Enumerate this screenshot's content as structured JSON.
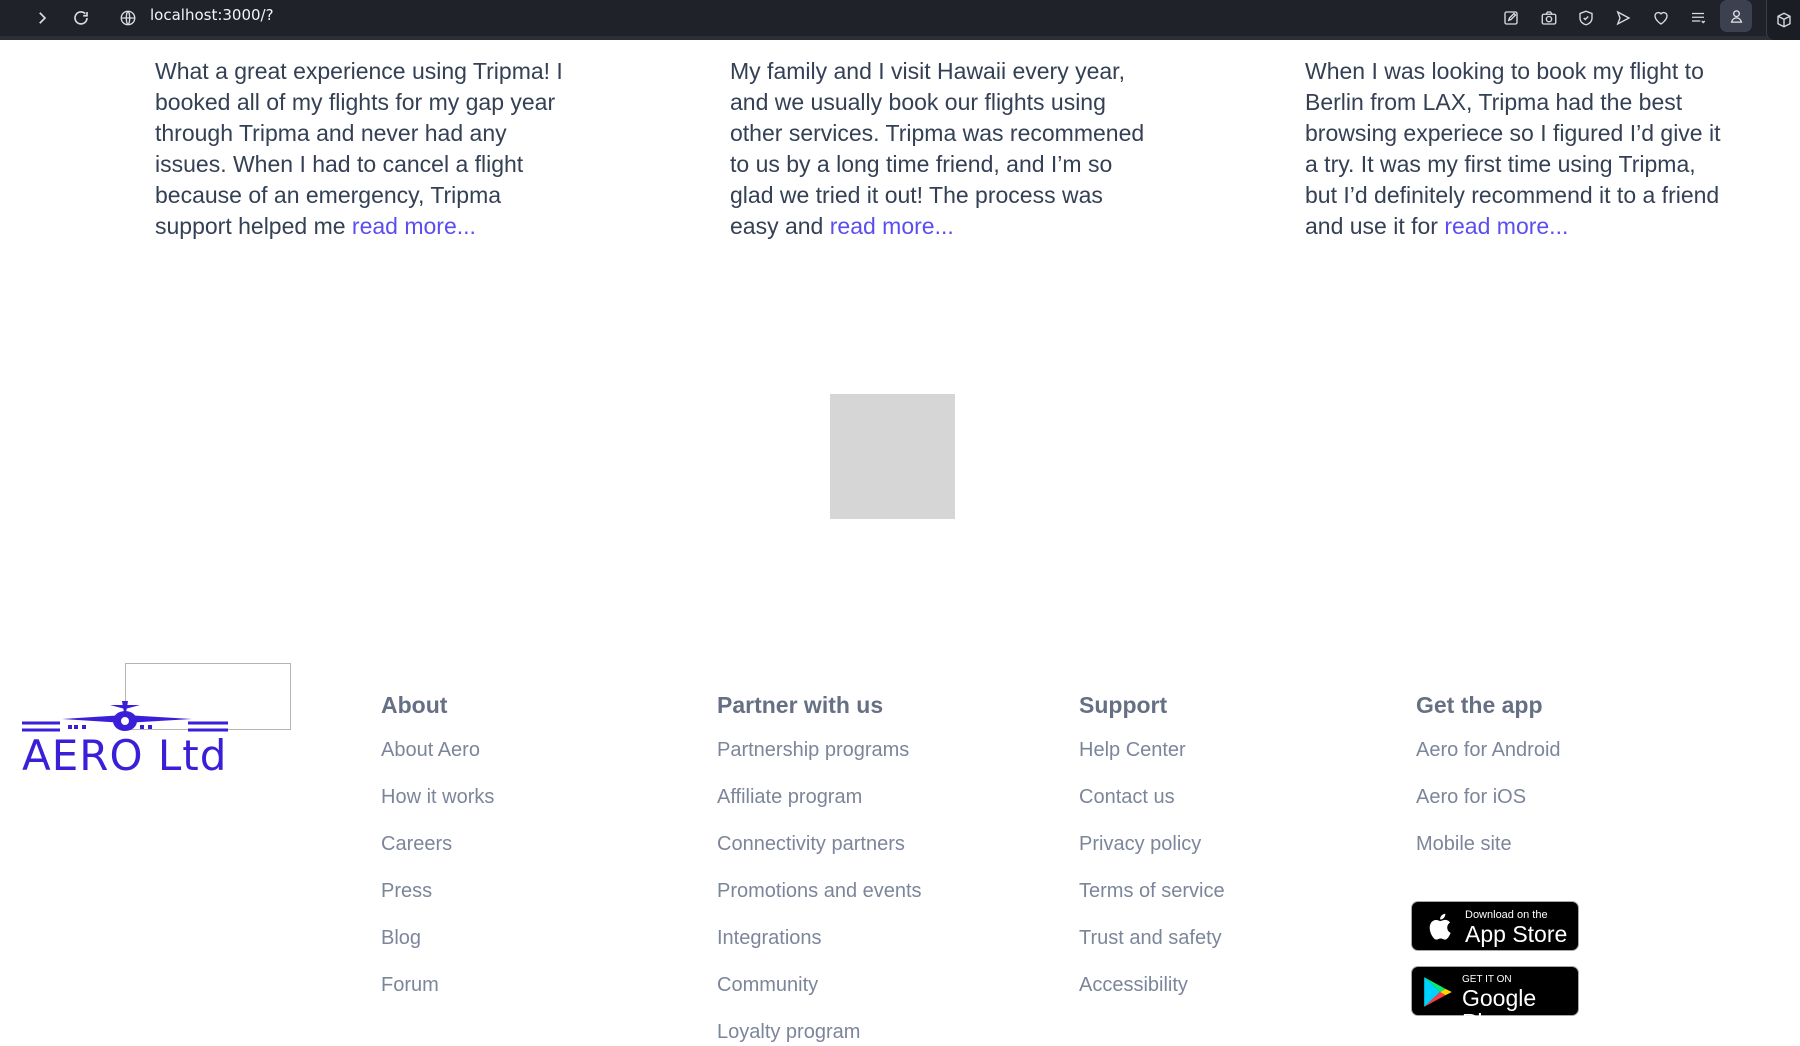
{
  "browser": {
    "url": "localhost:3000/?"
  },
  "testimonials": [
    {
      "text": "What a great experience using Tripma! I booked all of my flights for my gap year through Tripma and never had any issues. When I had to cancel a flight because of an emergency, Tripma support helped me ",
      "more": "read more..."
    },
    {
      "text": "My family and I visit Hawaii every year, and we usually book our flights using other services. Tripma was recommened to us by a long time friend, and I’m so glad we tried it out! The process was easy and ",
      "more": "read more..."
    },
    {
      "text": "When I was looking to book my flight to Berlin from LAX, Tripma had the best browsing experiece so I figured I’d give it a try. It was my first time using Tripma, but I’d definitely recommend it to a friend and use it for ",
      "more": "read more..."
    }
  ],
  "footer": {
    "logo_text": "AERO Ltd",
    "columns": [
      {
        "title": "About",
        "links": [
          "About Aero",
          "How it works",
          "Careers",
          "Press",
          "Blog",
          "Forum"
        ]
      },
      {
        "title": "Partner with us",
        "links": [
          "Partnership programs",
          "Affiliate program",
          "Connectivity partners",
          "Promotions and events",
          "Integrations",
          "Community",
          "Loyalty program"
        ]
      },
      {
        "title": "Support",
        "links": [
          "Help Center",
          "Contact us",
          "Privacy policy",
          "Terms of service",
          "Trust and safety",
          "Accessibility"
        ]
      },
      {
        "title": "Get the app",
        "links": [
          "Aero for Android",
          "Aero for iOS",
          "Mobile site"
        ]
      }
    ],
    "app_store": {
      "small": "Download on the",
      "big": "App Store"
    },
    "google_play": {
      "small": "GET IT ON",
      "big": "Google Play"
    }
  },
  "colors": {
    "accent_link": "#5b4ef0",
    "logo": "#3a1fd8",
    "toolbar": "#1f2229"
  }
}
